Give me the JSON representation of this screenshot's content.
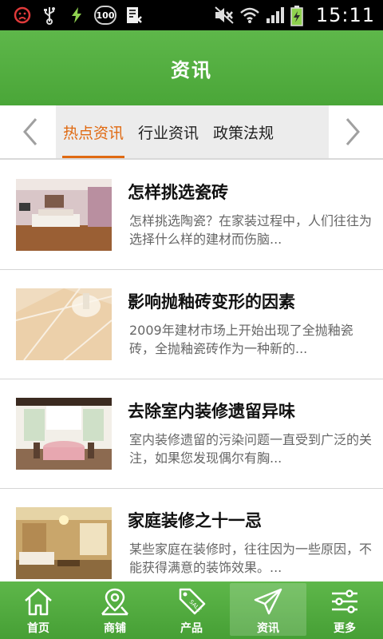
{
  "status_bar": {
    "time": "15:11",
    "battery_badge": "100",
    "icons": [
      "no-notify-icon",
      "usb-icon",
      "charging-bolt-icon",
      "battery-100-badge-icon",
      "app-icon",
      "mute-icon",
      "wifi-icon",
      "signal-icon",
      "battery-icon"
    ]
  },
  "header": {
    "title": "资讯"
  },
  "tabs": [
    {
      "label": "热点资讯",
      "active": true
    },
    {
      "label": "行业资讯",
      "active": false
    },
    {
      "label": "政策法规",
      "active": false
    }
  ],
  "news": [
    {
      "title": "怎样挑选瓷砖",
      "summary": "怎样挑选陶瓷？在家装过程中，人们往往为选择什么样的建材而伤脑..."
    },
    {
      "title": "影响抛釉砖变形的因素",
      "summary": "2009年建材市场上开始出现了全抛釉瓷砖，全抛釉瓷砖作为一种新的..."
    },
    {
      "title": "去除室内装修遗留异味",
      "summary": "室内装修遗留的污染问题一直受到广泛的关注，如果您发现偶尔有胸..."
    },
    {
      "title": "家庭装修之十一忌",
      "summary": "某些家庭在装修时，往往因为一些原因，不能获得满意的装饰效果。..."
    }
  ],
  "bottom_nav": [
    {
      "label": "首页",
      "icon": "home-icon",
      "active": false
    },
    {
      "label": "商铺",
      "icon": "map-pin-icon",
      "active": false
    },
    {
      "label": "产品",
      "icon": "sale-tag-icon",
      "active": false
    },
    {
      "label": "资讯",
      "icon": "paper-plane-icon",
      "active": true
    },
    {
      "label": "更多",
      "icon": "sliders-icon",
      "active": false
    }
  ],
  "colors": {
    "brand_green": "#4aa638",
    "active_tab": "#e06a12"
  }
}
